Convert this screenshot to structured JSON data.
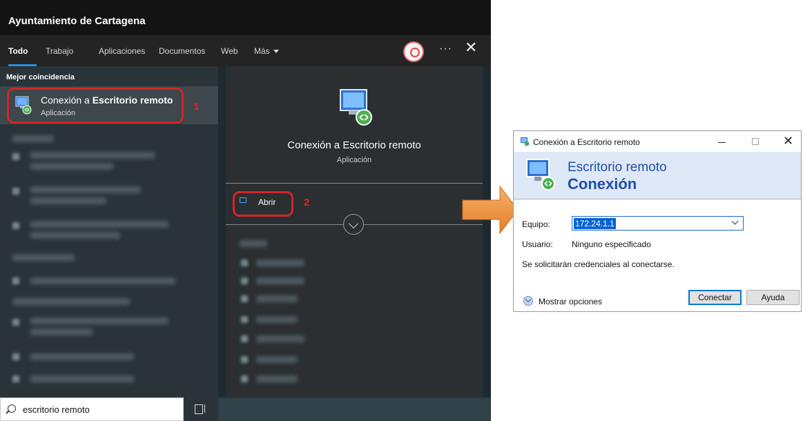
{
  "search_panel": {
    "org_name": "Ayuntamiento de Cartagena",
    "tabs": [
      {
        "label": "Todo"
      },
      {
        "label": "Trabajo"
      },
      {
        "label": "Aplicaciones"
      },
      {
        "label": "Documentos"
      },
      {
        "label": "Web"
      },
      {
        "label": "Más"
      }
    ],
    "more_icon": "ellipsis-icon",
    "close_icon": "close-icon",
    "best_match_header": "Mejor coincidencia",
    "best_match": {
      "title_prefix": "Conexión a",
      "title_bold": "Escritorio remoto",
      "subtitle": "Aplicación"
    },
    "detail": {
      "title": "Conexión a Escritorio remoto",
      "subtitle": "Aplicación",
      "open_label": "Abrir"
    },
    "search_query": "escritorio remoto"
  },
  "annotations": {
    "step1": "1",
    "step2": "2",
    "highlight_color": "#d4242b",
    "arrow_color": "#f08f3c"
  },
  "rdp_dialog": {
    "title": "Conexión a Escritorio remoto",
    "banner_line1": "Escritorio remoto",
    "banner_line2": "Conexión",
    "equipo_label": "Equipo:",
    "equipo_value": "172.24.1.1",
    "usuario_label": "Usuario:",
    "usuario_value": "Ninguno especificado",
    "credentials_note": "Se solicitarán credenciales al conectarse.",
    "show_options_label": "Mostrar opciones",
    "connect_button": "Conectar",
    "help_button": "Ayuda"
  }
}
